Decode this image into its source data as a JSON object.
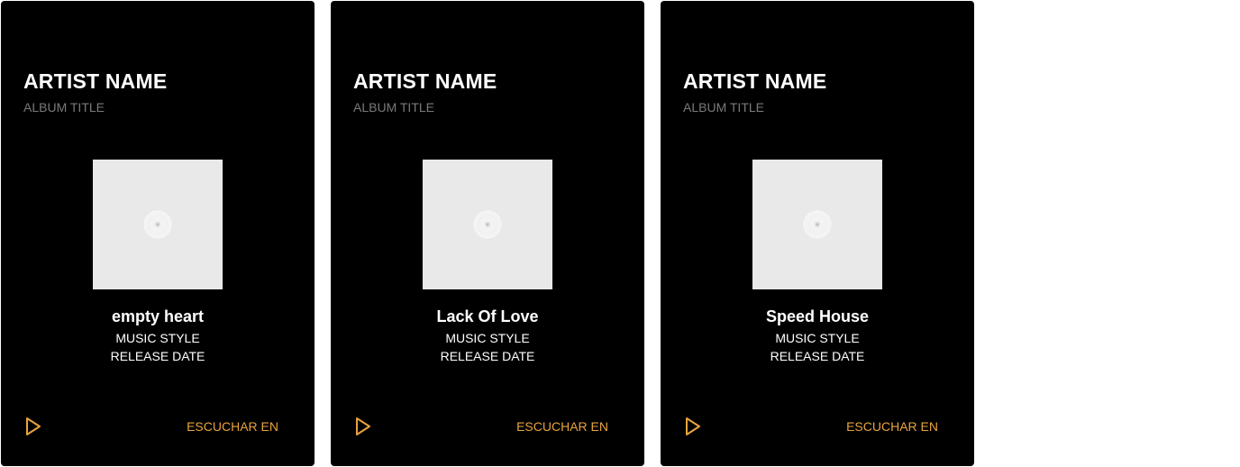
{
  "cards": [
    {
      "artist": "ARTIST NAME",
      "album": "ALBUM TITLE",
      "song": "empty heart",
      "style": "MUSIC STYLE",
      "date": "RELEASE DATE",
      "listen_label": "ESCUCHAR EN",
      "play_icon": "play-icon",
      "cover_icon": "vinyl-placeholder-icon"
    },
    {
      "artist": "ARTIST NAME",
      "album": "ALBUM TITLE",
      "song": "Lack Of Love",
      "style": "MUSIC STYLE",
      "date": "RELEASE DATE",
      "listen_label": "ESCUCHAR EN",
      "play_icon": "play-icon",
      "cover_icon": "vinyl-placeholder-icon"
    },
    {
      "artist": "ARTIST NAME",
      "album": "ALBUM TITLE",
      "song": "Speed House",
      "style": "MUSIC STYLE",
      "date": "RELEASE DATE",
      "listen_label": "ESCUCHAR EN",
      "play_icon": "play-icon",
      "cover_icon": "vinyl-placeholder-icon"
    }
  ],
  "colors": {
    "card_background": "#000000",
    "accent": "#e8a33d",
    "album_text": "#7a7a7a",
    "cover_placeholder": "#e9e9e9"
  }
}
